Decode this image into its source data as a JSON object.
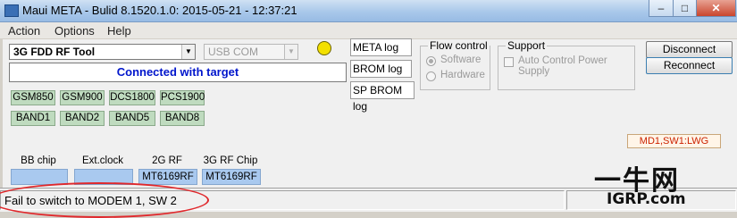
{
  "window": {
    "title": "Maui META - Bulid 8.1520.1.0: 2015-05-21 - 12:37:21"
  },
  "window_controls": {
    "minimize": "–",
    "maximize": "□",
    "close": "✕"
  },
  "menu": [
    "Action",
    "Options",
    "Help"
  ],
  "tool_select": {
    "value": "3G FDD RF Tool"
  },
  "port_select": {
    "value": "USB COM"
  },
  "status_led_color": "#f3e000",
  "connection_status": "Connected with target",
  "band_buttons_row1": [
    "GSM850",
    "GSM900",
    "DCS1800",
    "PCS1900"
  ],
  "band_buttons_row2": [
    "BAND1",
    "BAND2",
    "BAND5",
    "BAND8"
  ],
  "logs": {
    "meta": "META log",
    "brom": "BROM log",
    "sp_brom": "SP BROM log"
  },
  "flow_control": {
    "title": "Flow control",
    "options": [
      "Software",
      "Hardware"
    ],
    "selected": "Software"
  },
  "support": {
    "title": "Support",
    "checkbox_label": "Auto Control Power Supply"
  },
  "buttons": {
    "disconnect": "Disconnect",
    "reconnect": "Reconnect"
  },
  "modem_info": "MD1,SW1:LWG",
  "chip_info": {
    "bb_chip": {
      "label": "BB chip",
      "value": ""
    },
    "ext_clock": {
      "label": "Ext.clock",
      "value": ""
    },
    "rf_2g": {
      "label": "2G RF",
      "value": "MT6169RF"
    },
    "rf_3g": {
      "label": "3G RF Chip",
      "value": "MT6169RF"
    }
  },
  "status_bar": {
    "message": "Fail to switch to MODEM 1, SW 2"
  },
  "watermark": {
    "line1": "一牛网",
    "line2": "IGRP.com"
  },
  "colors": {
    "connected_text": "#0015cc",
    "band_green": "#bfdbbf",
    "chip_blue": "#a9c9ef",
    "annotation": "#e0282c"
  }
}
